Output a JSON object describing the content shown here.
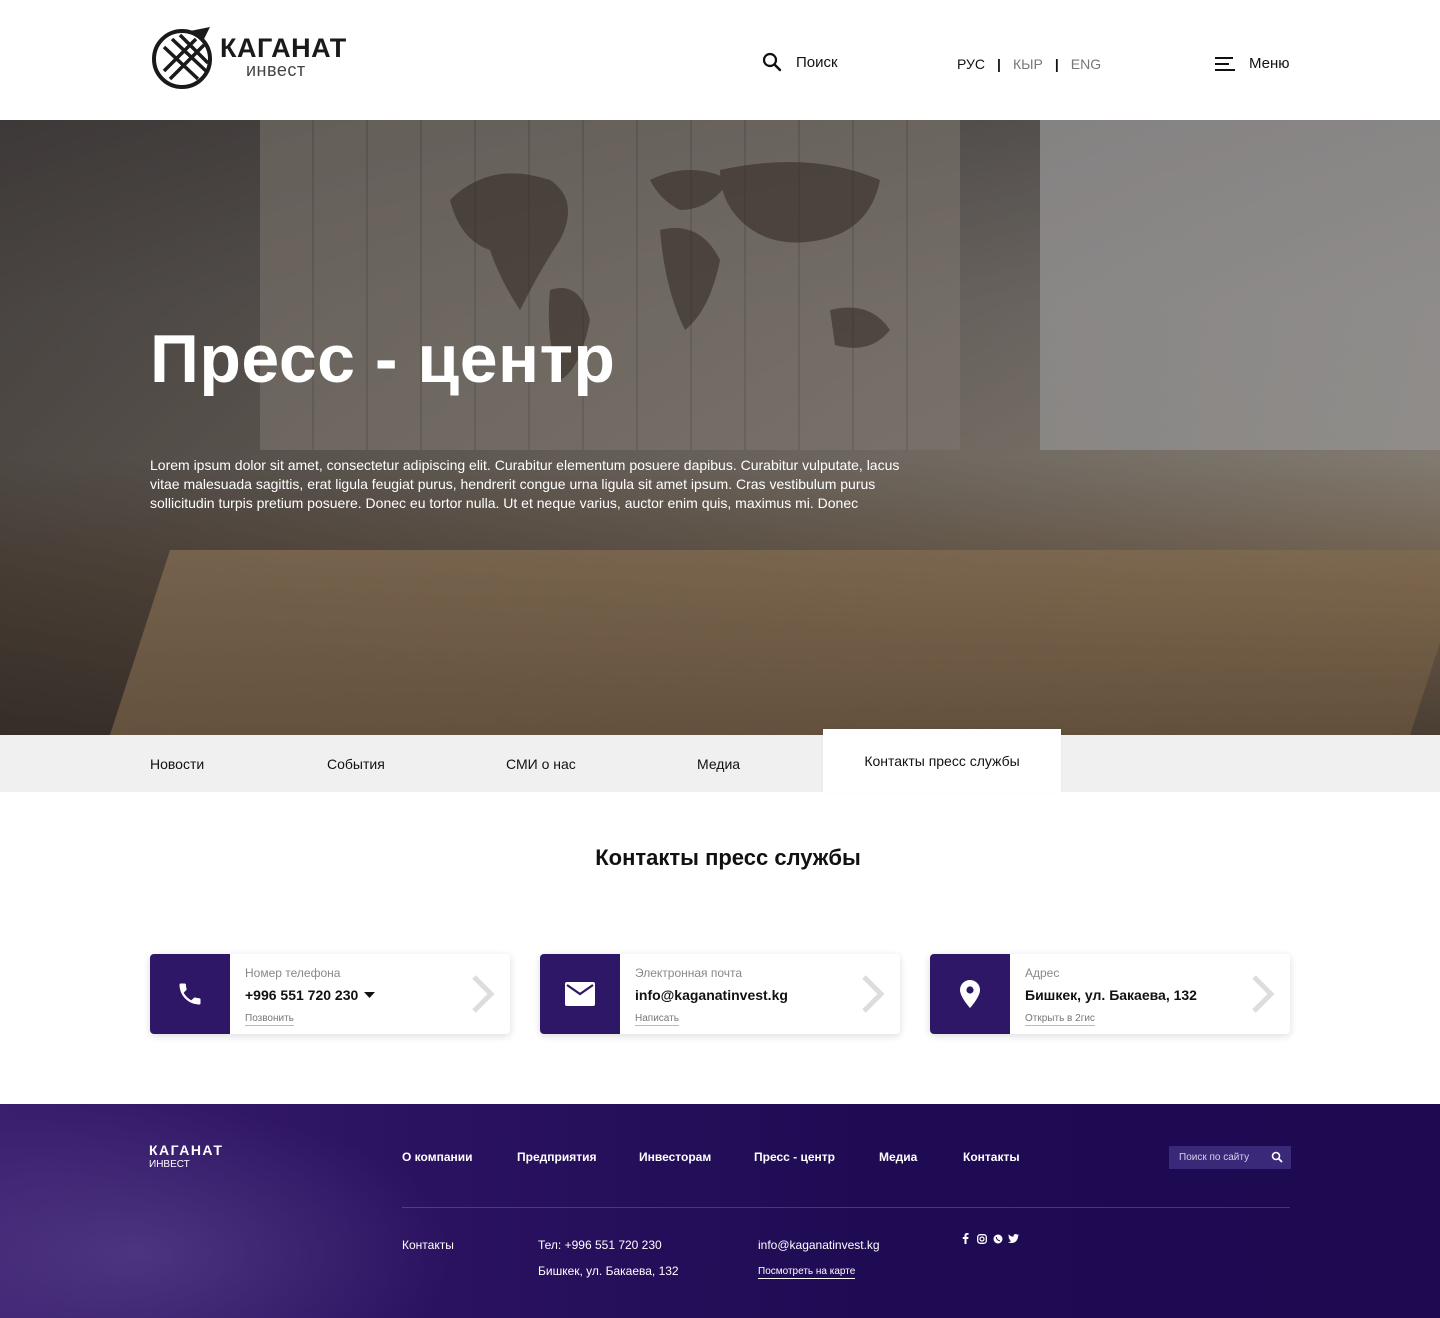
{
  "header": {
    "logo_main": "КАГАНАТ",
    "logo_sub": "инвест",
    "search_label": "Поиск",
    "languages": [
      "РУС",
      "КЫР",
      "ENG"
    ],
    "active_language": "РУС",
    "menu_label": "Меню"
  },
  "hero": {
    "title": "Пресс - центр",
    "text": "Lorem ipsum dolor sit amet, consectetur adipiscing elit. Curabitur elementum posuere dapibus. Curabitur vulputate, lacus vitae malesuada sagittis, erat ligula feugiat purus, hendrerit congue urna ligula sit amet ipsum. Cras vestibulum purus sollicitudin turpis pretium posuere. Donec eu tortor nulla. Ut et neque varius, auctor enim quis, maximus mi. Donec"
  },
  "tabs": [
    {
      "label": "Новости"
    },
    {
      "label": "События"
    },
    {
      "label": "СМИ о нас"
    },
    {
      "label": "Медиа"
    },
    {
      "label": "Контакты пресс службы"
    }
  ],
  "active_tab": "Контакты пресс службы",
  "section": {
    "title": "Контакты пресс службы"
  },
  "cards": [
    {
      "icon": "phone-icon",
      "label": "Номер телефона",
      "value": "+996 551 720 230",
      "action": "Позвонить"
    },
    {
      "icon": "mail-icon",
      "label": "Электронная почта",
      "value": "info@kaganatinvest.kg",
      "action": "Написать"
    },
    {
      "icon": "location-pin-icon",
      "label": "Адрес",
      "value": "Бишкек, ул. Бакаева, 132",
      "action": "Открыть в 2гис"
    }
  ],
  "footer": {
    "logo_main": "КАГАНАТ",
    "logo_sub": "ИНВЕСТ",
    "nav": [
      "О компании",
      "Предприятия",
      "Инвесторам",
      "Пресс - центр",
      "Медиа",
      "Контакты"
    ],
    "search_placeholder": "Поиск по сайту",
    "contacts_label": "Контакты",
    "phone": "Тел: +996 551 720 230",
    "address": "Бишкек, ул. Бакаева, 132",
    "email": "info@kaganatinvest.kg",
    "map_link": "Посмотреть на карте",
    "socials": [
      "facebook-icon",
      "instagram-icon",
      "whatsapp-icon",
      "twitter-icon"
    ]
  },
  "colors": {
    "accent": "#2e1766",
    "footer_bg": "#1f0b54",
    "tabs_bg": "#f0f0f0"
  }
}
